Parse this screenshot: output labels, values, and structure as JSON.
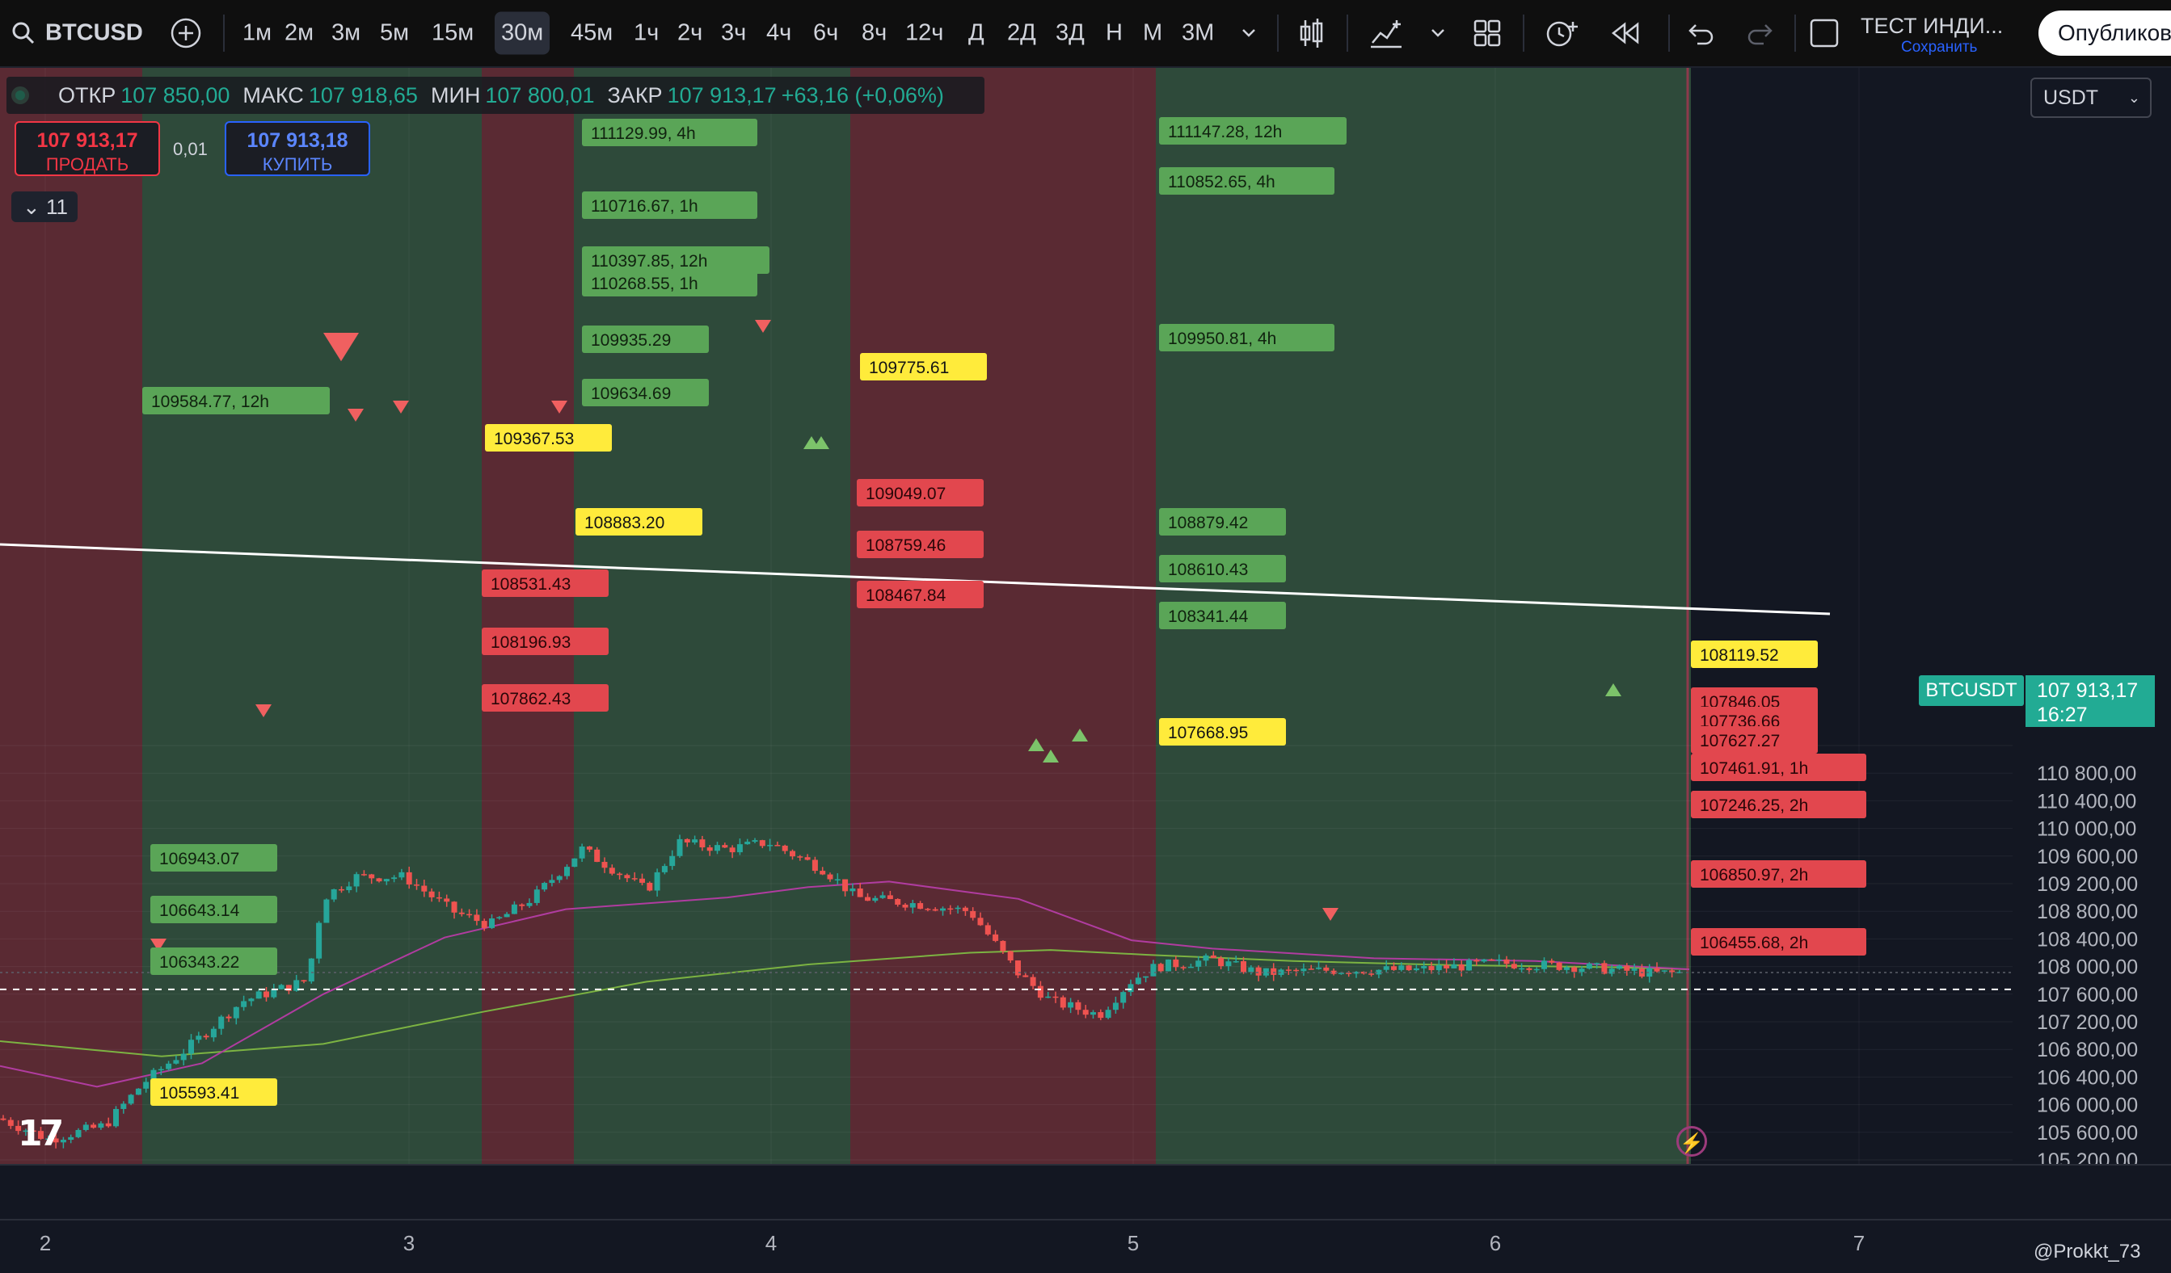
{
  "toolbar": {
    "symbol": "BTCUSD",
    "timeframes": [
      "1м",
      "2м",
      "3м",
      "5м",
      "15м",
      "30м",
      "45м",
      "1ч",
      "2ч",
      "3ч",
      "4ч",
      "6ч",
      "8ч",
      "12ч",
      "Д",
      "2Д",
      "3Д",
      "Н",
      "М",
      "3М"
    ],
    "active_timeframe": "30м",
    "indicator_name": "ТЕСТ ИНДИ...",
    "save_label": "Сохранить",
    "publish_label": "Опубликов"
  },
  "legend": {
    "open_label": "ОТКР",
    "open": "107 850,00",
    "high_label": "МАКС",
    "high": "107 918,65",
    "low_label": "МИН",
    "low": "107 800,01",
    "close_label": "ЗАКР",
    "close": "107 913,17",
    "change": "+63,16 (+0,06%)"
  },
  "trade": {
    "sell_price": "107 913,17",
    "sell_label": "ПРОДАТЬ",
    "spread": "0,01",
    "buy_price": "107 913,18",
    "buy_label": "КУПИТЬ",
    "indicators_count": "11"
  },
  "currency": "USDT",
  "last_price": {
    "symbol": "BTCUSDT",
    "price": "107 913,17",
    "countdown": "16:27"
  },
  "price_axis": [
    "110 800,00",
    "110 400,00",
    "110 000,00",
    "109 600,00",
    "109 200,00",
    "108 800,00",
    "108 400,00",
    "108 000,00",
    "107 600,00",
    "107 200,00",
    "106 800,00",
    "106 400,00",
    "106 000,00",
    "105 600,00",
    "105 200,00"
  ],
  "time_axis": [
    "2",
    "3",
    "4",
    "5",
    "6",
    "7"
  ],
  "watermark": "@Prokkt_73",
  "colors": {
    "up": "#26a69a",
    "down": "#ef5350",
    "green_zone": "#2e4a3a",
    "red_zone": "#5a2a33",
    "ma_fast": "#b03ca0",
    "ma_slow": "#7cb342"
  },
  "chart_data": {
    "type": "candlestick",
    "symbol": "BTCUSDT",
    "timeframe": "30м",
    "ylim": [
      105200,
      111200
    ],
    "x_ticks": [
      "2",
      "3",
      "4",
      "5",
      "6",
      "7"
    ],
    "current_price": 107913.17,
    "levels": [
      {
        "label": "111129.99, 4h",
        "price": 111129.99,
        "color": "green"
      },
      {
        "label": "110716.67, 1h",
        "price": 110716.67,
        "color": "green"
      },
      {
        "label": "110397.85, 12h",
        "price": 110397.85,
        "color": "green"
      },
      {
        "label": "110268.55, 1h",
        "price": 110268.55,
        "color": "green"
      },
      {
        "label": "109935.29",
        "price": 109935.29,
        "color": "green"
      },
      {
        "label": "109634.69",
        "price": 109634.69,
        "color": "green"
      },
      {
        "label": "109584.77, 12h",
        "price": 109584.77,
        "color": "green"
      },
      {
        "label": "109367.53",
        "price": 109367.53,
        "color": "yellow"
      },
      {
        "label": "108883.20",
        "price": 108883.2,
        "color": "yellow"
      },
      {
        "label": "108531.43",
        "price": 108531.43,
        "color": "red"
      },
      {
        "label": "108196.93",
        "price": 108196.93,
        "color": "red"
      },
      {
        "label": "107862.43",
        "price": 107862.43,
        "color": "red"
      },
      {
        "label": "106943.07",
        "price": 106943.07,
        "color": "green"
      },
      {
        "label": "106643.14",
        "price": 106643.14,
        "color": "green"
      },
      {
        "label": "106343.22",
        "price": 106343.22,
        "color": "green"
      },
      {
        "label": "105593.41",
        "price": 105593.41,
        "color": "yellow"
      },
      {
        "label": "109775.61",
        "price": 109775.61,
        "color": "yellow"
      },
      {
        "label": "109049.07",
        "price": 109049.07,
        "color": "red"
      },
      {
        "label": "108759.46",
        "price": 108759.46,
        "color": "red"
      },
      {
        "label": "108467.84",
        "price": 108467.84,
        "color": "red"
      },
      {
        "label": "111147.28, 12h",
        "price": 111147.28,
        "color": "green"
      },
      {
        "label": "110852.65, 4h",
        "price": 110852.65,
        "color": "green"
      },
      {
        "label": "109950.81, 4h",
        "price": 109950.81,
        "color": "green"
      },
      {
        "label": "108879.42",
        "price": 108879.42,
        "color": "green"
      },
      {
        "label": "108610.43",
        "price": 108610.43,
        "color": "green"
      },
      {
        "label": "108341.44",
        "price": 108341.44,
        "color": "green"
      },
      {
        "label": "107668.95",
        "price": 107668.95,
        "color": "yellow"
      },
      {
        "label": "108119.52",
        "price": 108119.52,
        "color": "yellow"
      },
      {
        "label": "107846.05",
        "price": 107846.05,
        "color": "red"
      },
      {
        "label": "107736.66",
        "price": 107736.66,
        "color": "red"
      },
      {
        "label": "107627.27",
        "price": 107627.27,
        "color": "red"
      },
      {
        "label": "107461.91, 1h",
        "price": 107461.91,
        "color": "red"
      },
      {
        "label": "107246.25, 2h",
        "price": 107246.25,
        "color": "red"
      },
      {
        "label": "106850.97, 2h",
        "price": 106850.97,
        "color": "red"
      },
      {
        "label": "106455.68, 2h",
        "price": 106455.68,
        "color": "red"
      }
    ]
  }
}
